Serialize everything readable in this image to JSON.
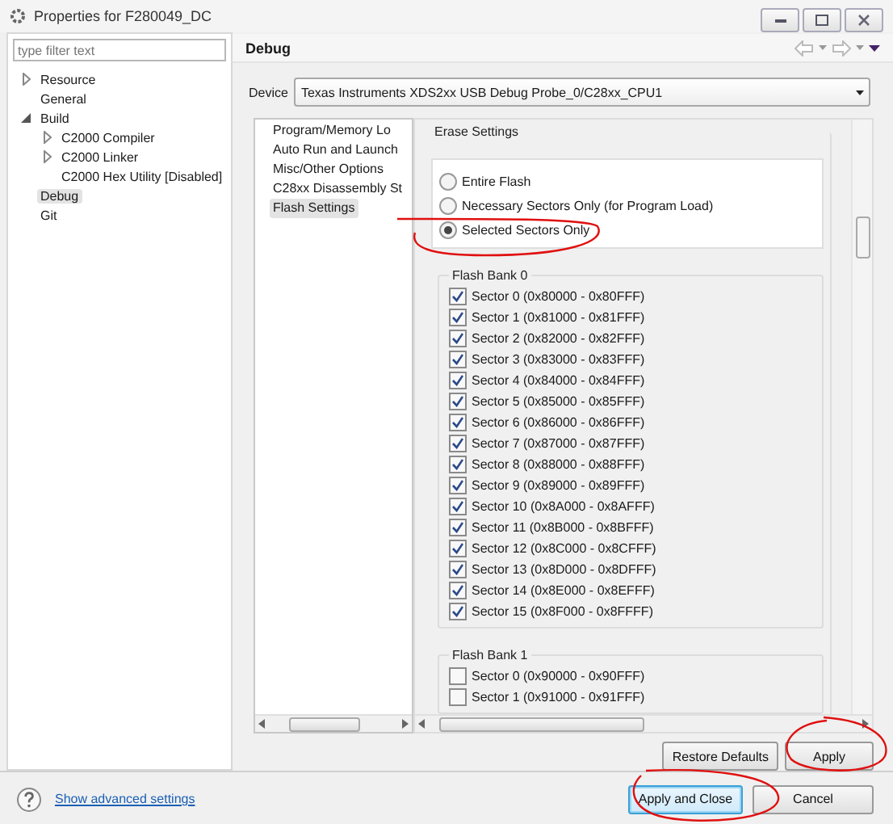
{
  "window": {
    "title": "Properties for F280049_DC"
  },
  "filter": {
    "placeholder": "type filter text"
  },
  "tree": [
    {
      "label": "Resource",
      "kind": "group",
      "expanded": false,
      "selected": false
    },
    {
      "label": "General",
      "kind": "leaf",
      "selected": false
    },
    {
      "label": "Build",
      "kind": "group",
      "expanded": true,
      "selected": false,
      "children": [
        {
          "label": "C2000 Compiler",
          "kind": "group",
          "expanded": false,
          "selected": false
        },
        {
          "label": "C2000 Linker",
          "kind": "group",
          "expanded": false,
          "selected": false
        },
        {
          "label": "C2000 Hex Utility  [Disabled]",
          "kind": "leaf",
          "selected": false
        }
      ]
    },
    {
      "label": "Debug",
      "kind": "leaf",
      "selected": true
    },
    {
      "label": "Git",
      "kind": "leaf",
      "selected": false
    }
  ],
  "page": {
    "title": "Debug",
    "device_label": "Device",
    "device": "Texas Instruments XDS2xx USB Debug Probe_0/C28xx_CPU1"
  },
  "categories": [
    {
      "label": "Program/Memory Lo",
      "selected": false
    },
    {
      "label": "Auto Run and Launch",
      "selected": false
    },
    {
      "label": "Misc/Other Options",
      "selected": false
    },
    {
      "label": "C28xx Disassembly St",
      "selected": false
    },
    {
      "label": "Flash Settings",
      "selected": true
    }
  ],
  "erase_settings": {
    "title": "Erase Settings",
    "options": [
      {
        "label": "Entire Flash",
        "selected": false
      },
      {
        "label": "Necessary Sectors Only (for Program Load)",
        "selected": false
      },
      {
        "label": "Selected Sectors Only",
        "selected": true
      }
    ]
  },
  "banks": [
    {
      "title": "Flash Bank 0",
      "sectors": [
        {
          "label": "Sector 0 (0x80000 - 0x80FFF)",
          "checked": true
        },
        {
          "label": "Sector 1 (0x81000 - 0x81FFF)",
          "checked": true
        },
        {
          "label": "Sector 2 (0x82000 - 0x82FFF)",
          "checked": true
        },
        {
          "label": "Sector 3 (0x83000 - 0x83FFF)",
          "checked": true
        },
        {
          "label": "Sector 4 (0x84000 - 0x84FFF)",
          "checked": true
        },
        {
          "label": "Sector 5 (0x85000 - 0x85FFF)",
          "checked": true
        },
        {
          "label": "Sector 6 (0x86000 - 0x86FFF)",
          "checked": true
        },
        {
          "label": "Sector 7 (0x87000 - 0x87FFF)",
          "checked": true
        },
        {
          "label": "Sector 8 (0x88000 - 0x88FFF)",
          "checked": true
        },
        {
          "label": "Sector 9 (0x89000 - 0x89FFF)",
          "checked": true
        },
        {
          "label": "Sector 10 (0x8A000 - 0x8AFFF)",
          "checked": true
        },
        {
          "label": "Sector 11 (0x8B000 - 0x8BFFF)",
          "checked": true
        },
        {
          "label": "Sector 12 (0x8C000 - 0x8CFFF)",
          "checked": true
        },
        {
          "label": "Sector 13 (0x8D000 - 0x8DFFF)",
          "checked": true
        },
        {
          "label": "Sector 14 (0x8E000 - 0x8EFFF)",
          "checked": true
        },
        {
          "label": "Sector 15 (0x8F000 - 0x8FFFF)",
          "checked": true
        }
      ]
    },
    {
      "title": "Flash Bank 1",
      "sectors": [
        {
          "label": "Sector 0 (0x90000 - 0x90FFF)",
          "checked": false
        },
        {
          "label": "Sector 1 (0x91000 - 0x91FFF)",
          "checked": false
        }
      ]
    }
  ],
  "page_buttons": [
    "Restore Defaults",
    "Apply"
  ],
  "footer": {
    "link": "Show advanced settings",
    "buttons": [
      {
        "label": "Apply and Close",
        "kind": "default"
      },
      {
        "label": "Cancel",
        "kind": "normal"
      }
    ]
  }
}
